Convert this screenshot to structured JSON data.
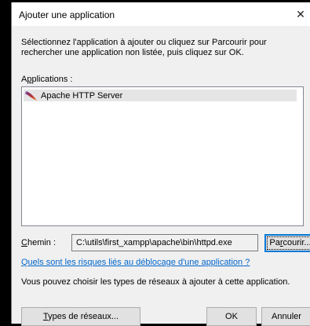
{
  "dialog": {
    "title": "Ajouter une application",
    "close_glyph": "✕",
    "instructions": "Sélectionnez l'application à ajouter ou cliquez sur Parcourir pour rechercher une application non listée, puis cliquez sur OK.",
    "apps_label_first": "A",
    "apps_label_accel": "p",
    "apps_label_rest": "plications :",
    "apps": [
      {
        "name": "Apache HTTP Server",
        "icon": "apache-feather-icon"
      }
    ],
    "path_label_accel": "C",
    "path_label_rest": "hemin :",
    "path_value": "C:\\utils\\first_xampp\\apache\\bin\\httpd.exe",
    "browse_first": "Pa",
    "browse_accel": "r",
    "browse_rest": "courir...",
    "risk_link": "Quels sont les risques liés au déblocage d'une application ?",
    "network_text": "Vous pouvez choisir les types de réseaux à ajouter à cette application.",
    "types_accel": "T",
    "types_rest": "ypes de réseaux...",
    "ok_label": "OK",
    "cancel_label": "Annuler"
  },
  "colors": {
    "link": "#0066cc",
    "focus_border": "#0078d7",
    "selection": "#e5e5e5"
  }
}
